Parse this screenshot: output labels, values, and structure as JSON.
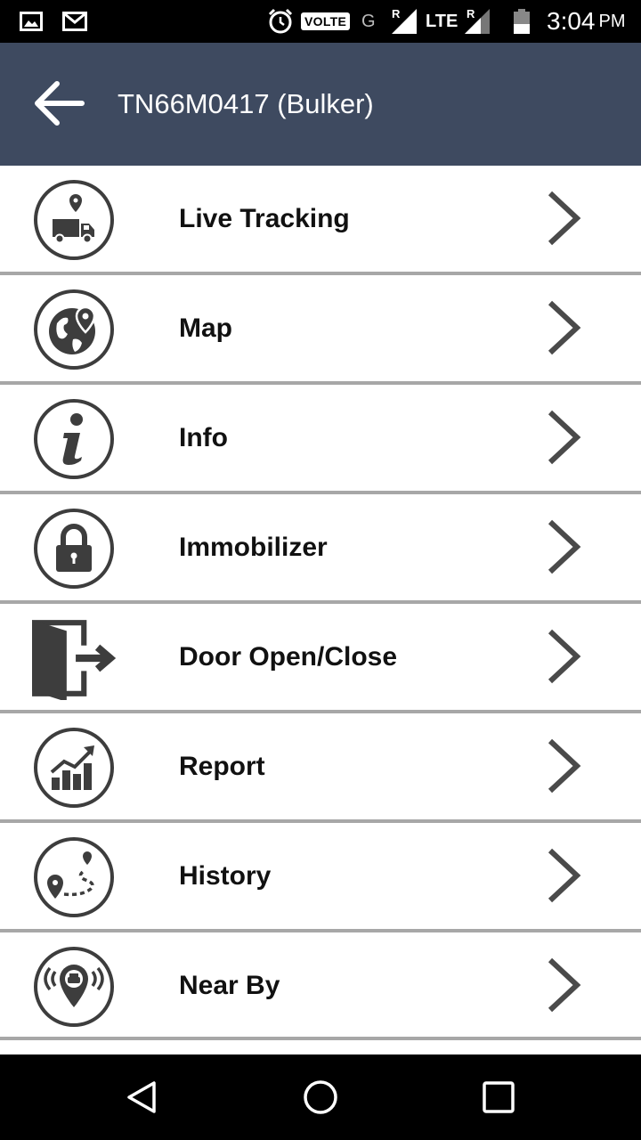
{
  "status_bar": {
    "volte": "VOLTE",
    "network_g": "G",
    "roaming_1": "R",
    "lte": "LTE",
    "roaming_2": "R",
    "time": "3:04",
    "ampm": "PM",
    "icons": [
      "gallery-icon",
      "gmail-icon",
      "alarm-icon",
      "signal-icon",
      "battery-icon"
    ]
  },
  "app_bar": {
    "title": "TN66M0417 (Bulker)",
    "back_icon": "arrow-left-icon"
  },
  "colors": {
    "app_bar": "#3e4a60",
    "icon_dark": "#3d3d3d",
    "divider": "#a7a7a7",
    "chevron": "#4a4a4a"
  },
  "menu": [
    {
      "label": "Live Tracking",
      "icon": "truck-location-icon"
    },
    {
      "label": "Map",
      "icon": "globe-pin-icon"
    },
    {
      "label": "Info",
      "icon": "info-icon"
    },
    {
      "label": "Immobilizer",
      "icon": "lock-icon"
    },
    {
      "label": "Door Open/Close",
      "icon": "door-exit-icon"
    },
    {
      "label": "Report",
      "icon": "report-chart-icon"
    },
    {
      "label": "History",
      "icon": "route-history-icon"
    },
    {
      "label": "Near By",
      "icon": "nearby-taxi-icon"
    }
  ],
  "nav_bar": {
    "icons": [
      "nav-back-icon",
      "nav-home-icon",
      "nav-recents-icon"
    ]
  }
}
